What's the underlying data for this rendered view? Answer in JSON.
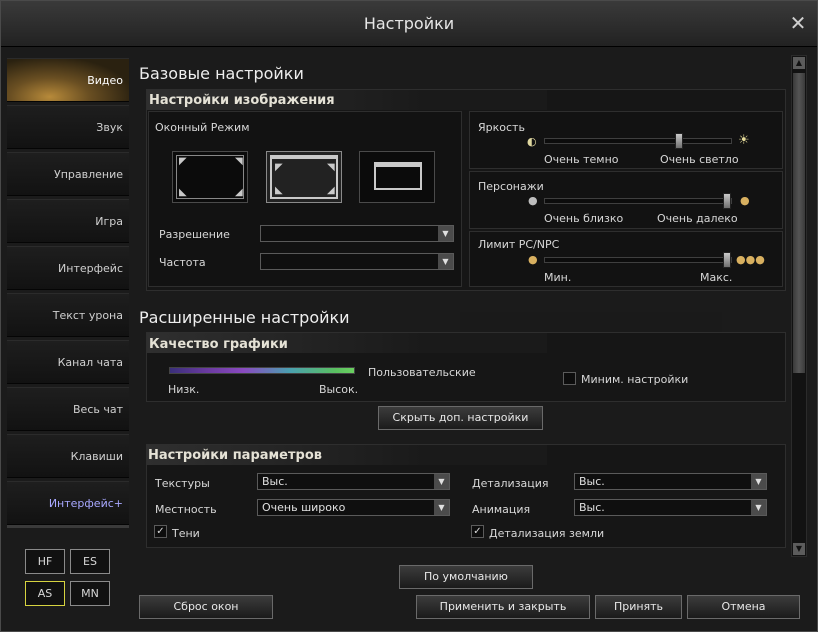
{
  "window": {
    "title": "Настройки"
  },
  "sidebar": {
    "items": [
      {
        "label": "Видео"
      },
      {
        "label": "Звук"
      },
      {
        "label": "Управление"
      },
      {
        "label": "Игра"
      },
      {
        "label": "Интерфейс"
      },
      {
        "label": "Текст урона"
      },
      {
        "label": "Канал чата"
      },
      {
        "label": "Весь чат"
      },
      {
        "label": "Клавиши"
      },
      {
        "label": "Интерфейс+"
      }
    ],
    "active_index": 0,
    "mini_buttons": [
      "HF",
      "ES",
      "AS",
      "MN"
    ],
    "mini_selected": "AS"
  },
  "basic": {
    "title": "Базовые настройки",
    "image_panel_title": "Настройки изображения",
    "window_mode_label": "Оконный Режим",
    "resolution_label": "Разрешение",
    "resolution_value": "",
    "frequency_label": "Частота",
    "frequency_value": "",
    "brightness": {
      "label": "Яркость",
      "min": "Очень темно",
      "max": "Очень светло",
      "level": 0.73
    },
    "characters": {
      "label": "Персонажи",
      "min": "Очень близко",
      "max": "Очень далеко",
      "level": 1.0
    },
    "pc_limit": {
      "label": "Лимит PC/NPC",
      "min": "Мин.",
      "max": "Макс.",
      "level": 1.0
    }
  },
  "advanced": {
    "title": "Расширенные настройки",
    "quality_panel_title": "Качество графики",
    "quality_preset": "Пользовательские",
    "quality_low": "Низк.",
    "quality_high": "Высок.",
    "min_settings_label": "Миним. настройки",
    "hide_extra_button": "Скрыть доп. настройки",
    "params_panel_title": "Настройки параметров",
    "textures_label": "Текстуры",
    "textures_value": "Выс.",
    "detail_label": "Детализация",
    "detail_value": "Выс.",
    "terrain_label": "Местность",
    "terrain_value": "Очень широко",
    "animation_label": "Анимация",
    "animation_value": "Выс.",
    "shadows_label": "Тени",
    "ground_detail_label": "Детализация земли"
  },
  "footer": {
    "default_button": "По умолчанию",
    "reset_windows_button": "Сброс окон",
    "apply_close_button": "Применить и закрыть",
    "accept_button": "Принять",
    "cancel_button": "Отмена"
  }
}
